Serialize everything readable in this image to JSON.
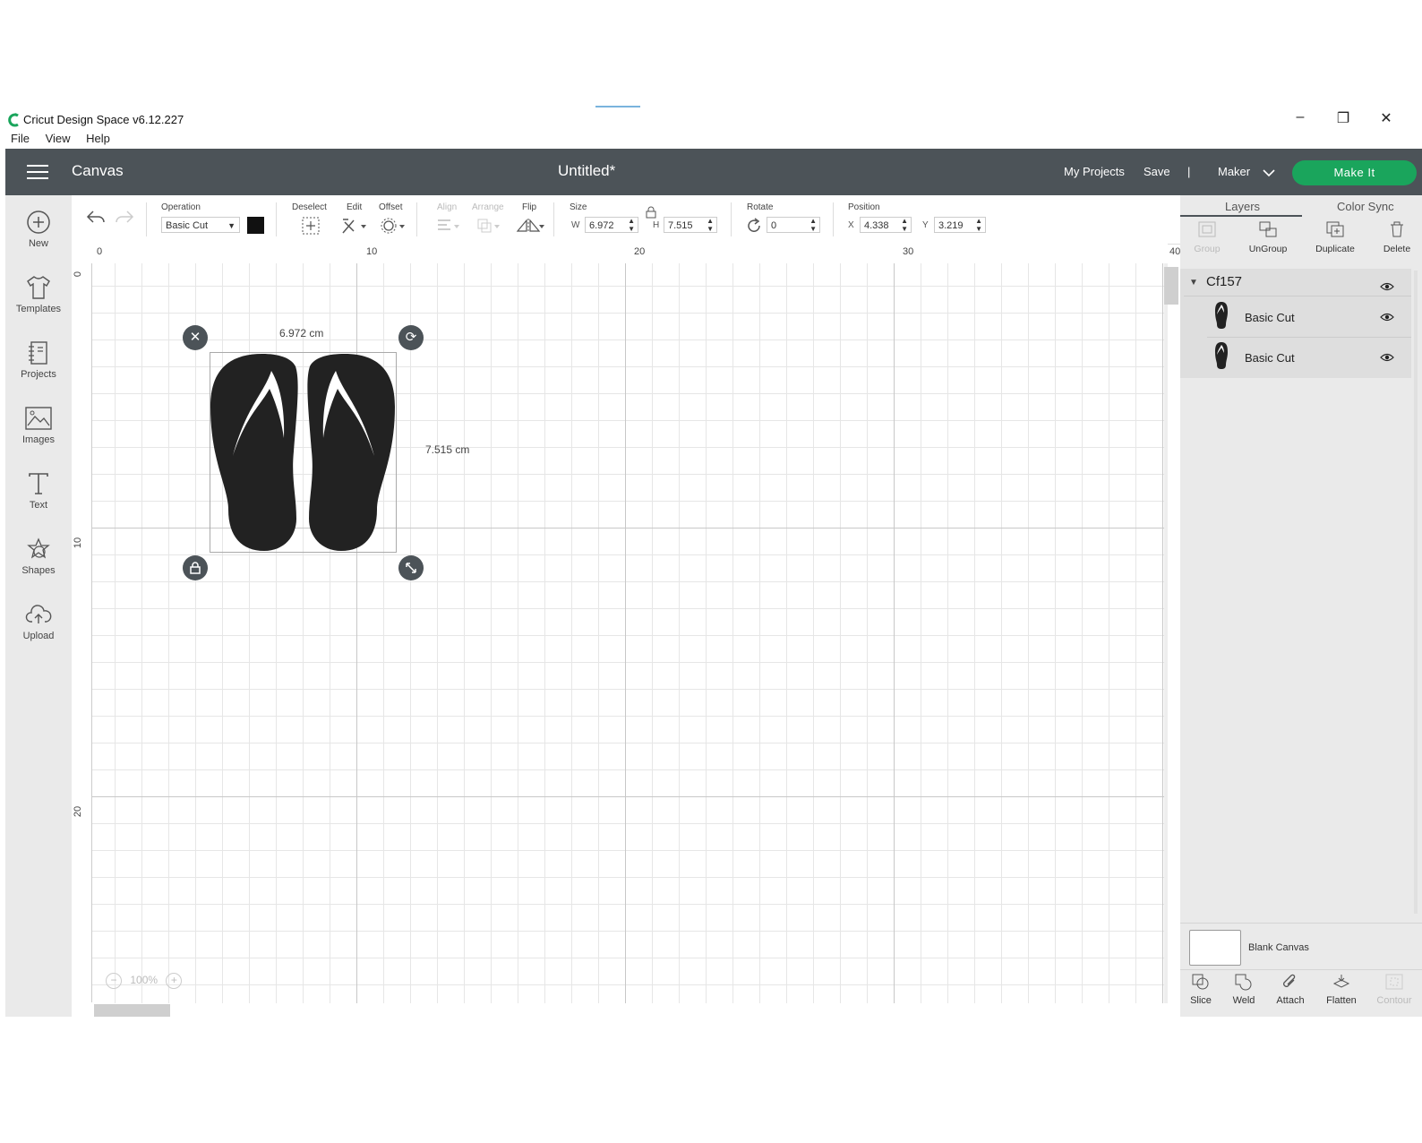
{
  "window": {
    "app_title": "Cricut Design Space  v6.12.227",
    "menu": [
      "File",
      "View",
      "Help"
    ],
    "minimize": "–",
    "restore": "❐",
    "close": "✕"
  },
  "header": {
    "section": "Canvas",
    "doc_title": "Untitled*",
    "my_projects": "My Projects",
    "save": "Save",
    "divider": "|",
    "machine": "Maker",
    "make_it": "Make It",
    "accent_color": "#1aa55c",
    "bar_color": "#4c5358"
  },
  "sidebar": {
    "items": [
      {
        "label": "New",
        "icon": "plus-circle-icon"
      },
      {
        "label": "Templates",
        "icon": "shirt-icon"
      },
      {
        "label": "Projects",
        "icon": "notebook-icon"
      },
      {
        "label": "Images",
        "icon": "image-icon"
      },
      {
        "label": "Text",
        "icon": "text-icon"
      },
      {
        "label": "Shapes",
        "icon": "shapes-icon"
      },
      {
        "label": "Upload",
        "icon": "cloud-upload-icon"
      }
    ]
  },
  "toolbar": {
    "operation_label": "Operation",
    "operation_value": "Basic Cut",
    "operation_color": "#111111",
    "deselect": "Deselect",
    "edit": "Edit",
    "offset": "Offset",
    "align": "Align",
    "arrange": "Arrange",
    "flip": "Flip",
    "size_label": "Size",
    "w_label": "W",
    "w_value": "6.972",
    "h_label": "H",
    "h_value": "7.515",
    "rotate_label": "Rotate",
    "rotate_value": "0",
    "position_label": "Position",
    "x_label": "X",
    "x_value": "4.338",
    "y_label": "Y",
    "y_value": "3.219"
  },
  "rulers": {
    "top": [
      "0",
      "10",
      "20",
      "30",
      "40"
    ],
    "left": [
      "0",
      "10",
      "20"
    ]
  },
  "canvas": {
    "width_label": "6.972 cm",
    "height_label": "7.515 cm",
    "zoom": "100%"
  },
  "panel": {
    "tabs": [
      "Layers",
      "Color Sync"
    ],
    "actions": [
      {
        "label": "Group",
        "enabled": false
      },
      {
        "label": "UnGroup",
        "enabled": true
      },
      {
        "label": "Duplicate",
        "enabled": true
      },
      {
        "label": "Delete",
        "enabled": true
      }
    ],
    "group_name": "Cf157",
    "layers": [
      {
        "label": "Basic Cut"
      },
      {
        "label": "Basic Cut"
      }
    ],
    "blank_canvas": "Blank Canvas",
    "bottom_actions": [
      {
        "label": "Slice",
        "enabled": true
      },
      {
        "label": "Weld",
        "enabled": true
      },
      {
        "label": "Attach",
        "enabled": true
      },
      {
        "label": "Flatten",
        "enabled": true
      },
      {
        "label": "Contour",
        "enabled": false
      }
    ]
  }
}
